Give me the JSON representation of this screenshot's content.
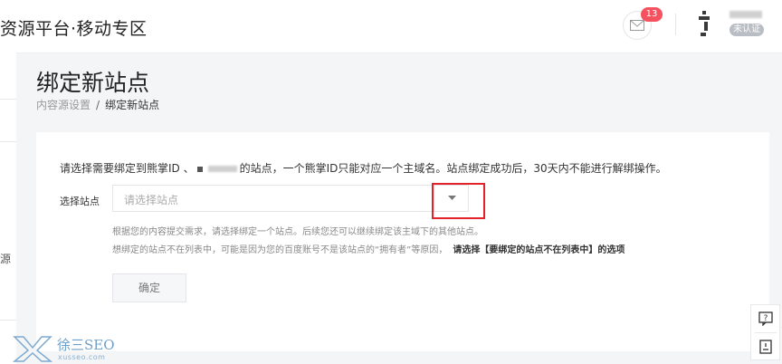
{
  "header": {
    "brand": "资源平台·移动专区",
    "message_count": "13",
    "unverified_label": "未认证"
  },
  "sidebar": {
    "partial_text": "源"
  },
  "page": {
    "title": "绑定新站点",
    "breadcrumb": {
      "parent": "内容源设置",
      "separator": "/",
      "current": "绑定新站点"
    }
  },
  "form": {
    "notice_before": "请选择需要绑定到熊掌ID 、",
    "notice_after": "的站点，一个熊掌ID只能对应一个主域名。站点绑定成功后，30天内不能进行解绑操作。",
    "site_label": "选择站点",
    "site_placeholder": "请选择站点",
    "hint_line1": "根据您的内容提交需求，请选择绑定一个站点。后续您还可以继续绑定该主域下的其他站点。",
    "hint_line2": "想绑定的站点不在列表中，可能是因为您的百度账号不是该站点的“拥有者”等原因，",
    "hint_line2_bold": "请选择【要绑定的站点不在列表中】的选项",
    "confirm_label": "确定"
  },
  "watermark": {
    "name": "徐三SEO",
    "domain": "xusseo.com"
  },
  "colors": {
    "badge": "#f5515f",
    "highlight_box": "#e3232a",
    "watermark": "#6fa0c9"
  }
}
